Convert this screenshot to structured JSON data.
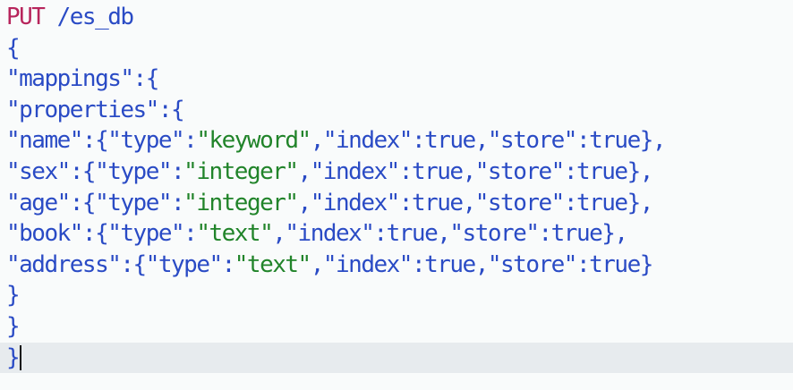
{
  "request": {
    "method": "PUT",
    "path": "/es_db"
  },
  "lines": {
    "open_brace": "{",
    "mappings_key": "\"mappings\"",
    "properties_key": "\"properties\"",
    "colon_open": ":{",
    "fields": [
      {
        "name": "\"name\"",
        "type": "\"keyword\"",
        "comma": ","
      },
      {
        "name": "\"sex\"",
        "type": "\"integer\"",
        "comma": ","
      },
      {
        "name": "\"age\"",
        "type": "\"integer\"",
        "comma": ","
      },
      {
        "name": "\"book\"",
        "type": "\"text\"",
        "comma": ","
      },
      {
        "name": "\"address\"",
        "type": "\"text\"",
        "comma": ""
      }
    ],
    "close_brace": "}"
  },
  "tokens": {
    "type_key": "\"type\"",
    "index_key": "\"index\"",
    "store_key": "\"store\"",
    "true_value": "true"
  },
  "colors": {
    "method": "#b7255c",
    "key": "#2a4bc5",
    "string": "#21842a",
    "background": "#f9fbfb",
    "active_line": "#e7ebee"
  }
}
